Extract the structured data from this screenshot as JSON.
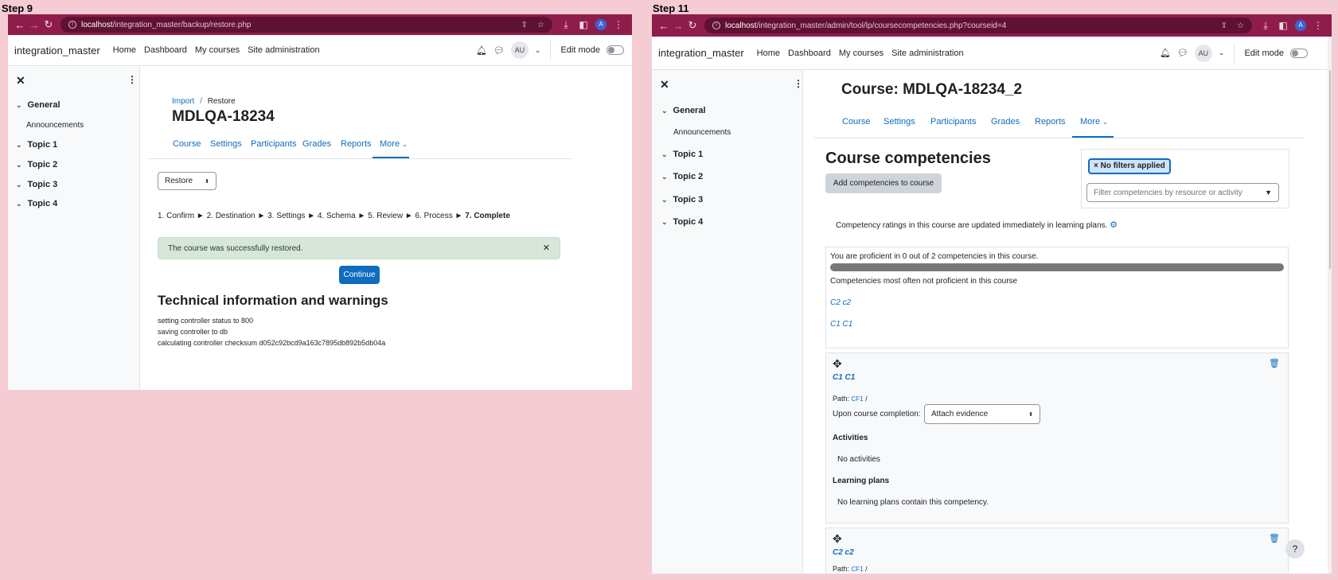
{
  "left": {
    "step_label": "Step 9",
    "browser": {
      "url_host": "localhost",
      "url_path": "/integration_master/backup/restore.php",
      "avatar_letter": "A"
    },
    "navbar": {
      "brand": "integration_master",
      "links": [
        "Home",
        "Dashboard",
        "My courses",
        "Site administration"
      ],
      "user_initials": "AU",
      "edit_mode_label": "Edit mode"
    },
    "drawer": {
      "sections": [
        "General",
        "Topic 1",
        "Topic 2",
        "Topic 3",
        "Topic 4"
      ],
      "sub_item": "Announcements"
    },
    "breadcrumb": {
      "link": "Import",
      "separator": "/",
      "current": "Restore"
    },
    "page_title": "MDLQA-18234",
    "tabs": [
      "Course",
      "Settings",
      "Participants",
      "Grades",
      "Reports",
      "More"
    ],
    "select_value": "Restore",
    "steps_text": "1. Confirm ► 2. Destination ► 3. Settings ► 4. Schema ► 5. Review ► 6. Process ► ",
    "steps_current": "7. Complete",
    "alert_text": "The course was successfully restored.",
    "continue_label": "Continue",
    "tech_heading": "Technical information and warnings",
    "tech_lines": [
      "setting controller status to 800",
      "saving controller to db",
      "calculating controller checksum d052c92bcd9a163c7895db892b5db04a"
    ]
  },
  "right": {
    "step_label": "Step 11",
    "browser": {
      "url_host": "localhost",
      "url_path": "/integration_master/admin/tool/lp/coursecompetencies.php?courseid=4",
      "avatar_letter": "A"
    },
    "navbar": {
      "brand": "integration_master",
      "links": [
        "Home",
        "Dashboard",
        "My courses",
        "Site administration"
      ],
      "user_initials": "AU",
      "edit_mode_label": "Edit mode"
    },
    "drawer": {
      "sections": [
        "General",
        "Topic 1",
        "Topic 2",
        "Topic 3",
        "Topic 4"
      ],
      "sub_item": "Announcements"
    },
    "course_title": "Course: MDLQA-18234_2",
    "tabs": [
      "Course",
      "Settings",
      "Participants",
      "Grades",
      "Reports",
      "More"
    ],
    "heading": "Course competencies",
    "add_button": "Add competencies to course",
    "filter_badge": "× No filters applied",
    "filter_placeholder": "Filter competencies by resource or activity",
    "ratings_note": "Competency ratings in this course are updated immediately in learning plans.",
    "proficient_text": "You are proficient in 0 out of 2 competencies in this course.",
    "proficient_fraction": 0,
    "not_proficient_heading": "Competencies most often not proficient in this course",
    "not_proficient_links": [
      "C2 c2",
      "C1 C1"
    ],
    "competencies": [
      {
        "title": "C1 C1",
        "path_label": "Path:",
        "path_link": "CF1",
        "path_sep": "/",
        "completion_label": "Upon course completion:",
        "completion_value": "Attach evidence",
        "activities_heading": "Activities",
        "activities_text": "No activities",
        "plans_heading": "Learning plans",
        "plans_text": "No learning plans contain this competency."
      },
      {
        "title": "C2 c2",
        "path_label": "Path:",
        "path_link": "CF1",
        "path_sep": "/"
      }
    ],
    "help_label": "?"
  }
}
